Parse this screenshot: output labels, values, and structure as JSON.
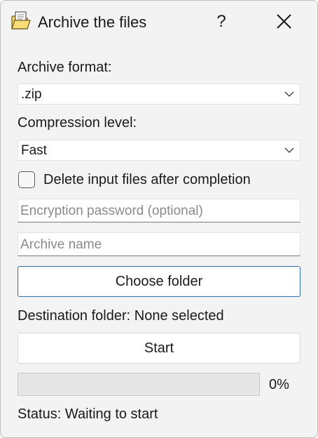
{
  "window": {
    "title": "Archive the files",
    "help_label": "?",
    "icons": {
      "app": "archive-folder-icon",
      "close": "close-icon"
    }
  },
  "form": {
    "archive_format": {
      "label": "Archive format:",
      "value": ".zip"
    },
    "compression_level": {
      "label": "Compression level:",
      "value": "Fast"
    },
    "delete_input": {
      "label": "Delete input files after completion",
      "checked": false
    },
    "encryption_password": {
      "value": "",
      "placeholder": "Encryption password (optional)"
    },
    "archive_name": {
      "value": "",
      "placeholder": "Archive name"
    },
    "choose_folder_label": "Choose folder",
    "destination_text": "Destination folder: None selected",
    "start_label": "Start",
    "progress": {
      "value": 0,
      "text": "0%"
    },
    "status_text": "Status: Waiting to start"
  },
  "colors": {
    "accent_border": "#2f6fb0",
    "progress_fill": "#06b025",
    "window_bg": "#f3f3f3"
  }
}
